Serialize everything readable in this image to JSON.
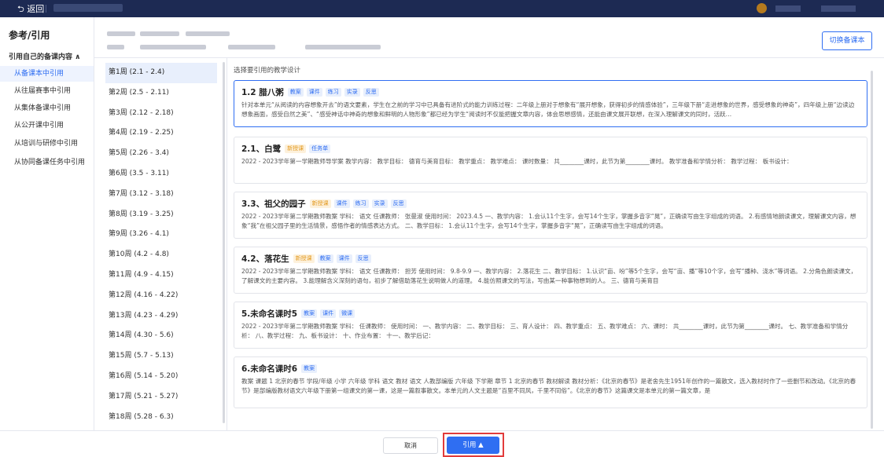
{
  "topbar": {
    "back_label": "返回"
  },
  "sidebar": {
    "title": "参考/引用",
    "section_label": "引用自己的备课内容 ∧",
    "items": [
      {
        "label": "从备课本中引用"
      },
      {
        "label": "从往届赛事中引用"
      },
      {
        "label": "从集体备课中引用"
      },
      {
        "label": "从公开课中引用"
      },
      {
        "label": "从培训与研修中引用"
      },
      {
        "label": "从协同备课任务中引用"
      }
    ]
  },
  "header": {
    "switch_button": "切换备课本"
  },
  "weeks": [
    "第1周 (2.1 - 2.4)",
    "第2周 (2.5 - 2.11)",
    "第3周 (2.12 - 2.18)",
    "第4周 (2.19 - 2.25)",
    "第5周 (2.26 - 3.4)",
    "第6周 (3.5 - 3.11)",
    "第7周 (3.12 - 3.18)",
    "第8周 (3.19 - 3.25)",
    "第9周 (3.26 - 4.1)",
    "第10周 (4.2 - 4.8)",
    "第11周 (4.9 - 4.15)",
    "第12周 (4.16 - 4.22)",
    "第13周 (4.23 - 4.29)",
    "第14周 (4.30 - 5.6)",
    "第15周 (5.7 - 5.13)",
    "第16周 (5.14 - 5.20)",
    "第17周 (5.21 - 5.27)",
    "第18周 (5.28 - 6.3)"
  ],
  "main": {
    "prompt": "选择要引用的教学设计",
    "cards": [
      {
        "title": "1.2 腊八粥",
        "tags": [
          {
            "text": "教案"
          },
          {
            "text": "课件"
          },
          {
            "text": "练习"
          },
          {
            "text": "实录"
          },
          {
            "text": "反思"
          }
        ],
        "body": "针对本单元“从阅读的内容想象开去”的语文要素，学生在之前的学习中已具备有进阶式的能力训练过程：二年级上册对于想象有“展开想象，获得初步的情感体验”，三年级下册“走进想象的世界，感受想象的神奇”，四年级上册“边读边想象画面，感受自然之美”、“感受神话中神奇的想象和鲜明的人物形象”都已经为学生“阅读时不仅能把握文章内容，体会思想感情，还能由课文展开联想，在深入理解课文的同时，活跃…"
      },
      {
        "title": "2.1、白鹭",
        "tags": [
          {
            "text": "新授课",
            "new": true
          },
          {
            "text": "任务单"
          }
        ],
        "body": "2022 - 2023学年第一学期教师导学案 教学内容：  教学目标：  德育与美育目标：  教学重点：  教学难点：  课时数量：  共________课时，此节为第________课时。 教学准备和学情分析：  教学过程：  板书设计："
      },
      {
        "title": "3.3、祖父的园子",
        "tags": [
          {
            "text": "新授课",
            "new": true
          },
          {
            "text": "课件"
          },
          {
            "text": "练习"
          },
          {
            "text": "实录"
          },
          {
            "text": "反思"
          }
        ],
        "body": "2022 - 2023学年第二学期教师教案 学科：  语文 任课教师：  张曼淑 使用时间：  2023.4.5 一、教学内容：  1.会认11个生字，会写14个生字，掌握多音字“晃”，正确读写由生字组成的词语。 2.有感情地朗读课文，理解课文内容，想象“我”在祖父园子里的生活情景，感悟作者的情感表达方式。  二、教学目标：  1.会认11个生字，会写14个生字，掌握多音字“晃”，正确读写由生字组成的词语。"
      },
      {
        "title": "4.2、落花生",
        "tags": [
          {
            "text": "新授课",
            "new": true
          },
          {
            "text": "教案"
          },
          {
            "text": "课件"
          },
          {
            "text": "反思"
          }
        ],
        "body": "2022 - 2023学年第二学期教师教案 学科：  语文 任课教师：  担芳 使用时间：  9.8-9.9 一、教学内容：  2.落花生 二、教学目标：  1.认识“亩、吩”等5个生字，会写“亩、播”等10个字，会写“播种、浇水”等词语。 2.分角色朗读课文，了解课文的主要内容。 3.能理解含义深刻的语句，初步了解借助落花生说明做人的道理。 4.能仿照课文的写法，写由某一种事物想到的人。  三、德育与美育目"
      },
      {
        "title": "5.未命名课时5",
        "tags": [
          {
            "text": "教案"
          },
          {
            "text": "课件"
          },
          {
            "text": "微课"
          }
        ],
        "body": "2022 - 2023学年第二学期教师教案 学科：  任课教师：  使用时间：  一、教学内容：  二、教学目标：  三、育人设计：  四、教学重点：  五、教学难点：  六、课时：  共________课时，此节为第________课时。  七、教学准备和学情分析：  八、教学过程：  九、板书设计：  十、作业布置：  十一、教学后记："
      },
      {
        "title": "6.未命名课时6",
        "tags": [
          {
            "text": "教案"
          }
        ],
        "body": "教案 课题 1 北京的春节 学段/年级 小学 六年级 学科 语文 教材 语文 人教部编版 六年级 下学期 章节 1 北京的春节 教材解读 教材分析：《北京的春节》是老舍先生1951年创作的一篇散文，选入教材时作了一些删节和改动。《北京的春节》是部编版教材语文六年级下册第一组课文的第一课，这是一篇叙事散文。本单元的人文主题是“百里不同风，千里不同俗”。《北京的春节》这篇课文是本单元的第一篇文章，是"
      }
    ]
  },
  "footer": {
    "cancel_label": "取消",
    "cite_label": "引用 ▲"
  },
  "colors": {
    "accent": "#2f6ef2",
    "topbar": "#1d2a53",
    "highlight": "#e23b3b",
    "new_tag": "#e39a21"
  }
}
